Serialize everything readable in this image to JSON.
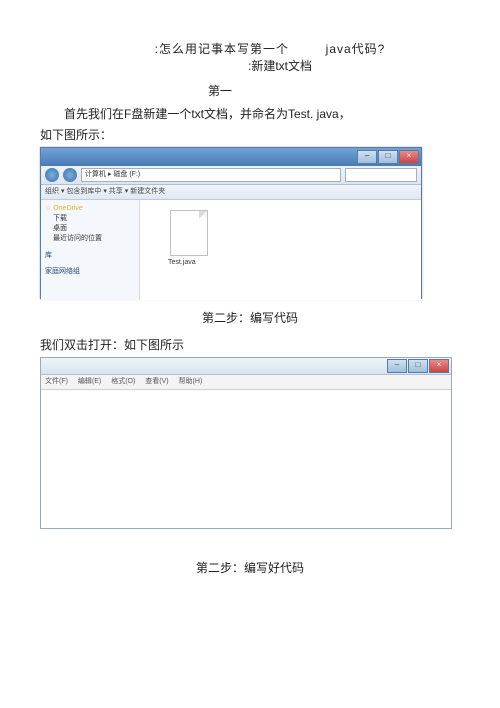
{
  "title": {
    "line1_a": ":怎么用记事本写第一个",
    "line1_b": "java代码?",
    "line2": ":新建txt文档"
  },
  "step1_label": "第一",
  "para1": "首先我们在F盘新建一个txt文档，并命名为Test. java，",
  "para1b": "如下图所示：",
  "explorer": {
    "addr": "计算机 ▸ 磁盘 (F:)",
    "menu": "组织 ▾   包含到库中 ▾   共享 ▾   新建文件夹",
    "sidebar": {
      "fav_title": "☆ OneDrive",
      "fav1": "下载",
      "fav2": "桌面",
      "fav3": "最近访问的位置",
      "lib_title": "库",
      "net_title": "家庭网络组"
    },
    "file_name": "Test.java"
  },
  "step2_label": "第二步：编写代码",
  "para2": "我们双击打开：如下图所示",
  "notepad": {
    "menu": {
      "file": "文件(F)",
      "edit": "编辑(E)",
      "format": "格式(O)",
      "view": "查看(V)",
      "help": "帮助(H)"
    }
  },
  "step2b_label": "第二步：编写好代码"
}
